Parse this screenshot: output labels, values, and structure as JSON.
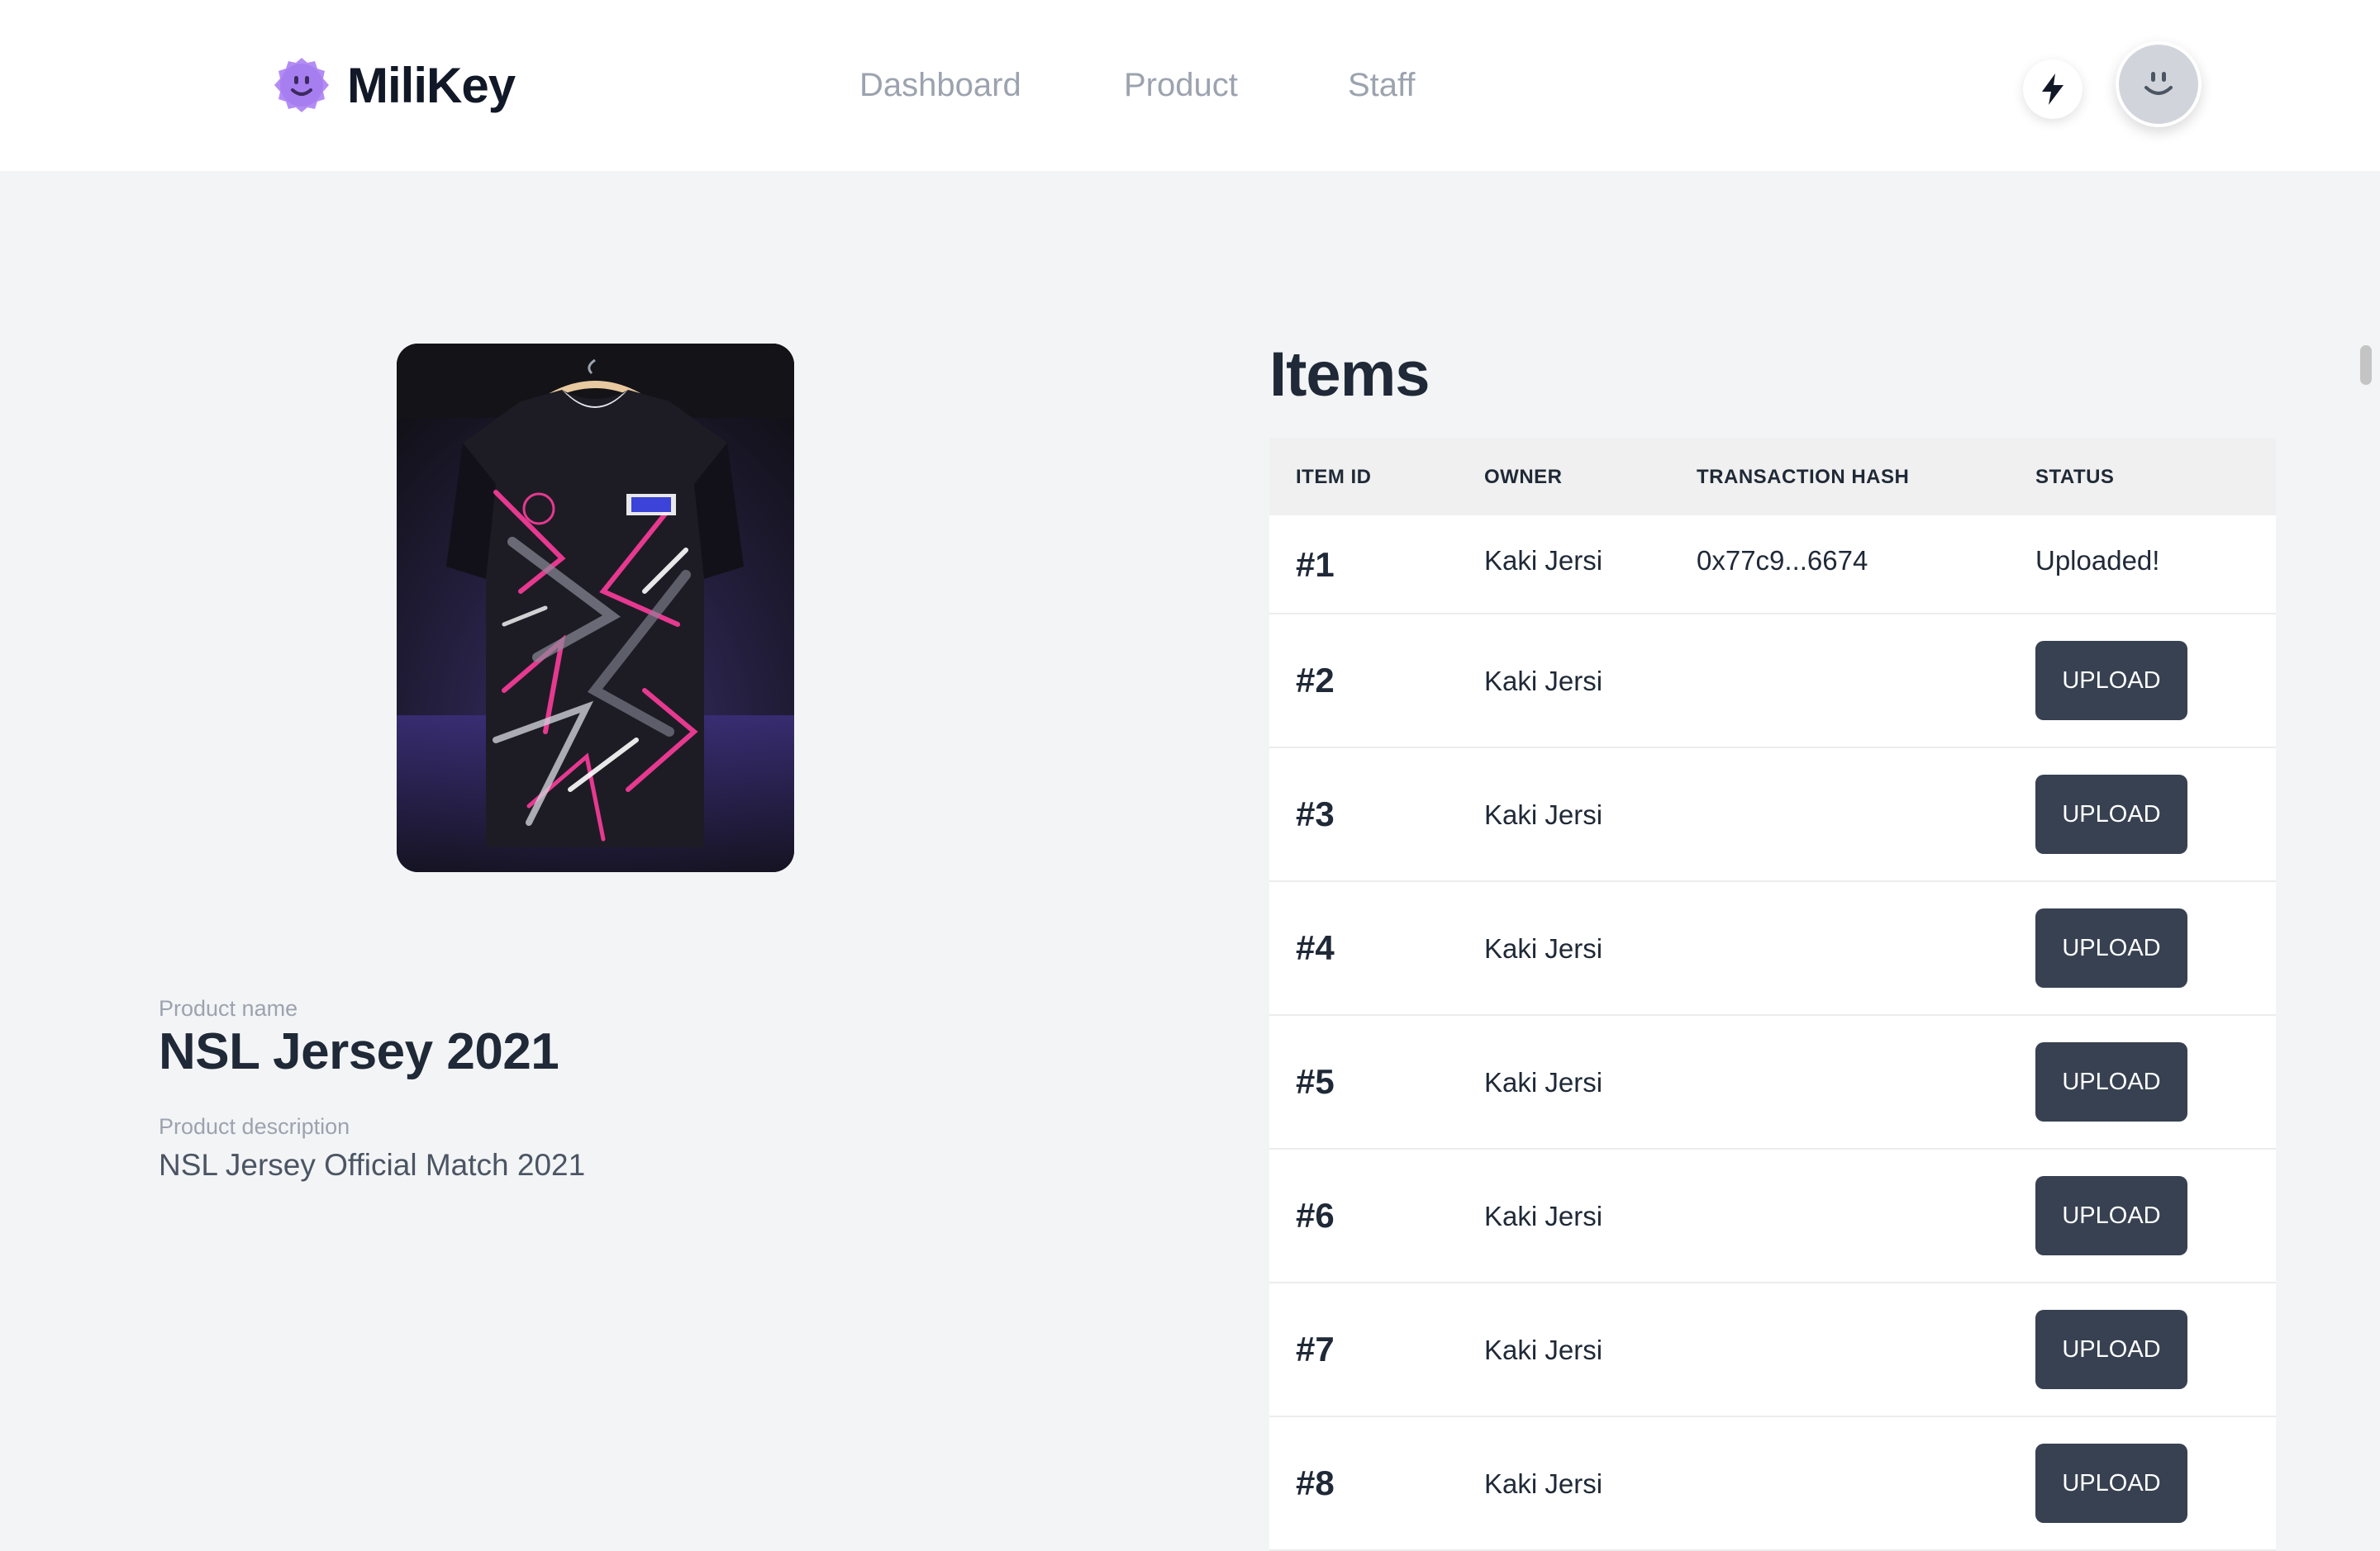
{
  "app": {
    "brand": "MiliKey",
    "brand_color": "#a78bfa"
  },
  "nav": {
    "items": [
      {
        "label": "Dashboard"
      },
      {
        "label": "Product"
      },
      {
        "label": "Staff"
      }
    ]
  },
  "header_actions": {
    "bolt_icon": "lightning-icon",
    "avatar_icon": "smiley-avatar-icon"
  },
  "product": {
    "name_label": "Product name",
    "name": "NSL Jersey 2021",
    "description_label": "Product description",
    "description": "NSL Jersey Official Match 2021",
    "image_alt": "NSL jersey on hanger"
  },
  "items": {
    "title": "Items",
    "columns": [
      "ITEM ID",
      "OWNER",
      "TRANSACTION HASH",
      "STATUS"
    ],
    "upload_label": "UPLOAD",
    "rows": [
      {
        "id": "#1",
        "owner": "Kaki Jersi",
        "hash": "0x77c9...6674",
        "status": "Uploaded!"
      },
      {
        "id": "#2",
        "owner": "Kaki Jersi",
        "hash": "",
        "status": "UPLOAD"
      },
      {
        "id": "#3",
        "owner": "Kaki Jersi",
        "hash": "",
        "status": "UPLOAD"
      },
      {
        "id": "#4",
        "owner": "Kaki Jersi",
        "hash": "",
        "status": "UPLOAD"
      },
      {
        "id": "#5",
        "owner": "Kaki Jersi",
        "hash": "",
        "status": "UPLOAD"
      },
      {
        "id": "#6",
        "owner": "Kaki Jersi",
        "hash": "",
        "status": "UPLOAD"
      },
      {
        "id": "#7",
        "owner": "Kaki Jersi",
        "hash": "",
        "status": "UPLOAD"
      },
      {
        "id": "#8",
        "owner": "Kaki Jersi",
        "hash": "",
        "status": "UPLOAD"
      }
    ]
  }
}
